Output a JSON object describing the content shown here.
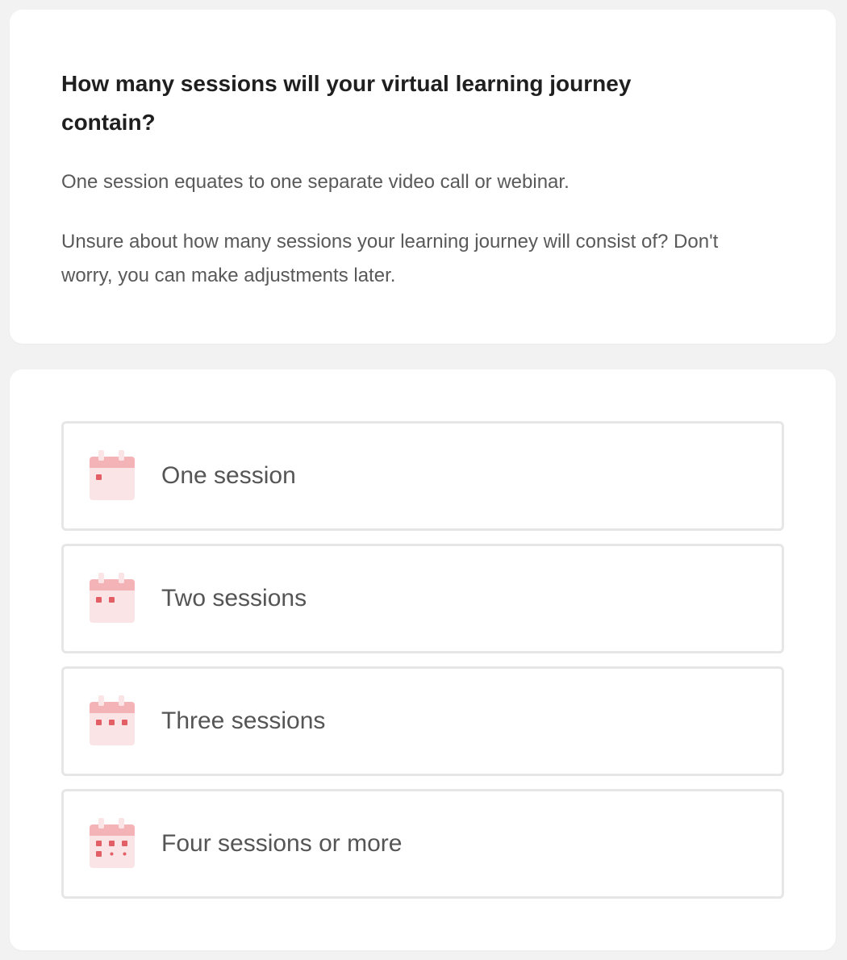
{
  "intro": {
    "question": "How many sessions will your virtual learning journey contain?",
    "desc1": "One session equates to one separate video call or webinar.",
    "desc2": "Unsure about how many sessions your learning journey will consist of? Don't worry, you can make adjustments later."
  },
  "options": [
    {
      "label": "One session",
      "icon": "calendar-one-icon",
      "dots": 1
    },
    {
      "label": "Two sessions",
      "icon": "calendar-two-icon",
      "dots": 2
    },
    {
      "label": "Three sessions",
      "icon": "calendar-three-icon",
      "dots": 3
    },
    {
      "label": "Four sessions or more",
      "icon": "calendar-four-plus-icon",
      "dots": 4
    }
  ],
  "colors": {
    "background": "#f2f2f2",
    "card": "#ffffff",
    "option_border": "#e6e6e6",
    "calendar_body": "#fbe4e5",
    "calendar_header": "#f4b4b7",
    "calendar_dot": "#e35f66"
  }
}
